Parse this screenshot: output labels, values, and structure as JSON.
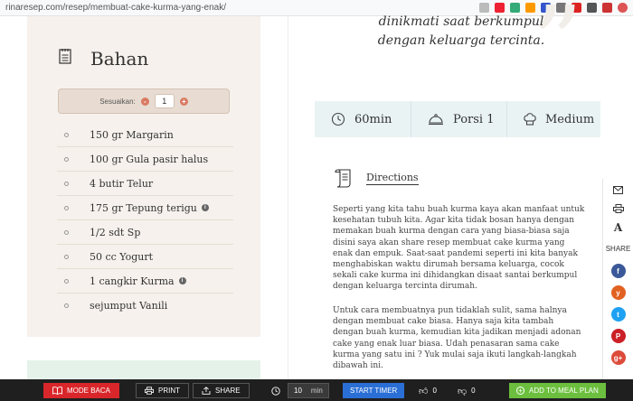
{
  "browser": {
    "url": "rinaresep.com/resep/membuat-cake-kurma-yang-enak/"
  },
  "ingredients": {
    "title": "Bahan",
    "adjust_label": "Sesuaikan:",
    "servings": "1",
    "minus": "-",
    "plus": "+",
    "items": [
      {
        "text": "150 gr Margarin"
      },
      {
        "text": "100 gr Gula pasir halus"
      },
      {
        "text": "4 butir Telur"
      },
      {
        "text": "175 gr Tepung terigu"
      },
      {
        "text": "1/2 sdt Sp"
      },
      {
        "text": "50 cc Yogurt"
      },
      {
        "text": "1 cangkir Kurma"
      },
      {
        "text": "sejumput Vanili"
      }
    ],
    "info_glyph": "i"
  },
  "quote": {
    "line1": "dinikmati saat berkumpul",
    "line2": "dengan keluarga tercinta.",
    "mark": "”"
  },
  "meta": {
    "time": "60min",
    "servings": "Porsi 1",
    "difficulty": "Medium"
  },
  "directions": {
    "title": "Directions",
    "para1": "Seperti yang kita tahu buah kurma kaya akan manfaat untuk kesehatan tubuh kita. Agar kita tidak bosan hanya dengan memakan buah kurma dengan cara yang biasa-biasa saja disini saya akan share resep membuat cake kurma yang enak dan empuk. Saat-saat pandemi seperti ini kita banyak menghabiskan waktu dirumah bersama keluarga, cocok sekali cake kurma ini dihidangkan disaat santai berkumpul dengan keluarga tercinta dirumah.",
    "para2": "Untuk cara membuatnya pun tidaklah sulit, sama halnya dengan membuat cake biasa. Hanya saja kita tambah dengan buah kurma, kemudian kita jadikan menjadi adonan cake yang enak luar biasa. Udah penasaran sama cake kurma yang satu ini ? Yuk mulai saja ikuti langkah-langkah dibawah ini."
  },
  "share_rail": {
    "font_label": "A",
    "share_label": "SHARE",
    "social": [
      {
        "name": "facebook",
        "glyph": "f",
        "color": "#3b5998"
      },
      {
        "name": "yummly",
        "glyph": "y",
        "color": "#e16120"
      },
      {
        "name": "twitter",
        "glyph": "t",
        "color": "#1da1f2"
      },
      {
        "name": "pinterest",
        "glyph": "P",
        "color": "#cb2027"
      },
      {
        "name": "google-plus",
        "glyph": "g+",
        "color": "#dd4b39"
      }
    ]
  },
  "bottom_bar": {
    "read_mode": "MODE BACA",
    "print": "PRINT",
    "share": "SHARE",
    "timer_value": "10",
    "timer_unit": "min",
    "start_timer": "START TIMER",
    "likes": "0",
    "dislikes": "0",
    "meal_plan": "ADD TO MEAL PLAN"
  },
  "colors": {
    "ingredient_bg": "#f6f1ec",
    "meta_bg": "#e9f3f4",
    "read_mode": "#d9262a",
    "start_timer": "#2a6fd6",
    "meal_plan": "#6cbf3e"
  }
}
